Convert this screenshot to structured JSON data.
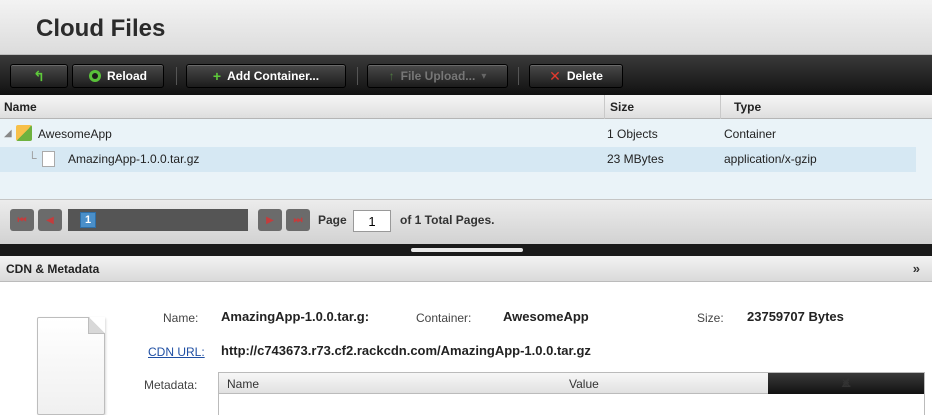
{
  "app": {
    "title": "Cloud Files"
  },
  "toolbar": {
    "reload": "Reload",
    "add_container": "Add Container...",
    "file_upload": "File Upload...",
    "delete": "Delete"
  },
  "grid": {
    "headers": {
      "name": "Name",
      "size": "Size",
      "type": "Type"
    },
    "rows": [
      {
        "name": "AwesomeApp",
        "size": "1 Objects",
        "type": "Container",
        "icon": "folder-cube-icon"
      },
      {
        "name": "AmazingApp-1.0.0.tar.gz",
        "size": "23 MBytes",
        "type": "application/x-gzip",
        "icon": "file-icon"
      }
    ]
  },
  "pager": {
    "current_thumb": "1",
    "page_label": "Page",
    "page_value": "1",
    "total_text": "of 1 Total Pages."
  },
  "panel": {
    "title": "CDN & Metadata",
    "chevron": "»"
  },
  "detail": {
    "name_label": "Name:",
    "name_value": "AmazingApp-1.0.0.tar.g:",
    "container_label": "Container:",
    "container_value": "AwesomeApp",
    "size_label": "Size:",
    "size_value": "23759707 Bytes",
    "cdn_label": "CDN URL:",
    "cdn_value": "http://c743673.r73.cf2.rackcdn.com/AmazingApp-1.0.0.tar.gz",
    "metadata_label": "Metadata:",
    "meta_headers": {
      "name": "Name",
      "value": "Value"
    }
  },
  "colors": {
    "accent_green": "#5ecb3a",
    "delete_red": "#e23a2e",
    "selection": "#d6e8f3",
    "link": "#1f4fa3"
  }
}
